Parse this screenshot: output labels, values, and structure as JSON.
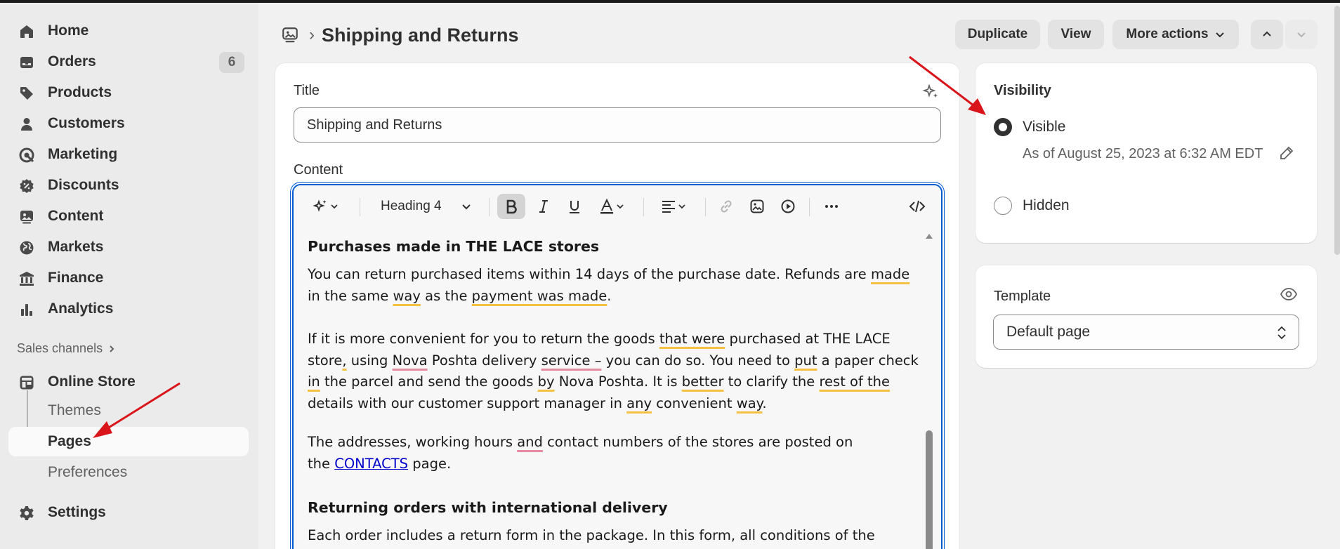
{
  "sidebar": {
    "items": [
      {
        "label": "Home",
        "icon": "home-icon"
      },
      {
        "label": "Orders",
        "icon": "inbox-icon",
        "badge": "6"
      },
      {
        "label": "Products",
        "icon": "tag-icon"
      },
      {
        "label": "Customers",
        "icon": "person-icon"
      },
      {
        "label": "Marketing",
        "icon": "target-icon"
      },
      {
        "label": "Discounts",
        "icon": "discount-icon"
      },
      {
        "label": "Content",
        "icon": "image-icon"
      },
      {
        "label": "Markets",
        "icon": "globe-icon"
      },
      {
        "label": "Finance",
        "icon": "bank-icon"
      },
      {
        "label": "Analytics",
        "icon": "chart-icon"
      }
    ],
    "sales_channels_label": "Sales channels",
    "online_store": {
      "label": "Online Store",
      "subitems": [
        {
          "label": "Themes",
          "active": false
        },
        {
          "label": "Pages",
          "active": true
        },
        {
          "label": "Preferences",
          "active": false
        }
      ]
    },
    "settings_label": "Settings"
  },
  "header": {
    "title": "Shipping and Returns",
    "breadcrumb_sep": "›",
    "buttons": {
      "duplicate": "Duplicate",
      "view": "View",
      "more_actions": "More actions"
    }
  },
  "editor_card": {
    "title_label": "Title",
    "title_value": "Shipping and Returns",
    "content_label": "Content",
    "toolbar": {
      "heading_select": "Heading 4"
    },
    "content": {
      "heading1": "Purchases made in THE LACE stores",
      "p1_a": "You can return purchased items within 14 days of the purchase date. Refunds are ",
      "p1_made": "made",
      "p1_b": " in the same ",
      "p1_way": "way",
      "p1_c": " as the ",
      "p1_payment": "payment was made",
      "p1_d": ".",
      "p2_a": "If it is more convenient for you to return the goods ",
      "p2_that": "that were",
      "p2_b": " purchased at THE LACE store",
      "p2_comma": ",",
      "p2_c": " using ",
      "p2_nova": "Nova",
      "p2_d": " Poshta delivery ",
      "p2_service": "service –",
      "p2_e": " you can do so. You need to ",
      "p2_put": "put",
      "p2_f": " a paper check ",
      "p2_in": "in",
      "p2_g": " the parcel and send the goods ",
      "p2_by": "by",
      "p2_h": " Nova Poshta. It is ",
      "p2_better": "better",
      "p2_i": " to clarify the ",
      "p2_rest": "rest of the",
      "p2_j": " details with our customer support manager in ",
      "p2_any": "any",
      "p2_k": " convenient ",
      "p2_way": "way",
      "p2_l": ".",
      "p3_a": "The addresses, working hours ",
      "p3_and": "and",
      "p3_b": " contact numbers of the stores are posted on the ",
      "p3_link": "CONTACTS",
      "p3_c": " page.",
      "heading2": "Returning orders with international delivery",
      "p4": "Each order includes a return form in the package. In this form, all conditions of the return"
    }
  },
  "visibility_card": {
    "title": "Visibility",
    "visible_label": "Visible",
    "visible_note": "As of August 25, 2023 at 6:32 AM EDT",
    "hidden_label": "Hidden",
    "selected": "Visible"
  },
  "template_card": {
    "label": "Template",
    "value": "Default page"
  },
  "colors": {
    "focus_blue": "#005bd3",
    "annotation_red": "#d9151b",
    "spell_yellow": "#f5c142",
    "spell_pink": "#e58aa0"
  }
}
